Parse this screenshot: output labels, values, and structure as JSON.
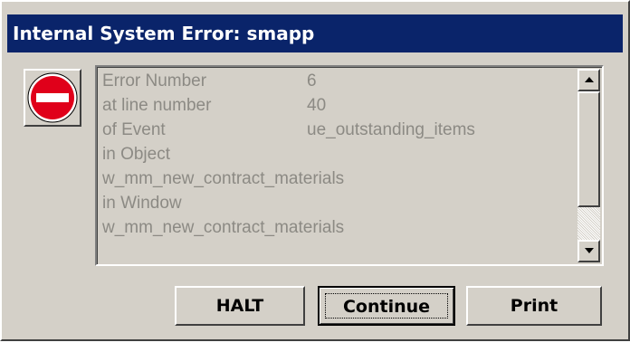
{
  "window": {
    "title": "Internal System Error: smapp"
  },
  "icon": {
    "name": "stop-icon",
    "color": "#e0001a"
  },
  "error_details": {
    "lines": [
      {
        "label": "Error Number",
        "value": "6"
      },
      {
        "label": "at line number",
        "value": "40"
      },
      {
        "label": "of Event",
        "value": "ue_outstanding_items"
      },
      {
        "label": "in Object",
        "value": ""
      },
      {
        "label": "w_mm_new_contract_materials",
        "value": ""
      },
      {
        "label": "in Window",
        "value": ""
      },
      {
        "label": "w_mm_new_contract_materials",
        "value": ""
      }
    ]
  },
  "buttons": {
    "halt_label": "HALT",
    "continue_label": "Continue",
    "print_label": "Print"
  },
  "colors": {
    "titlebar": "#0a246a",
    "face": "#d4d0c8",
    "disabled_text": "#8c8a84"
  }
}
